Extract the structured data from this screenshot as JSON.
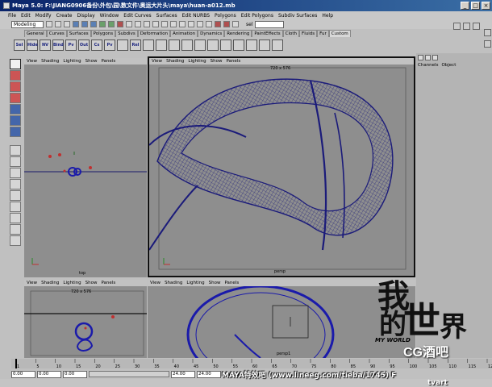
{
  "window": {
    "title": "Maya 5.0: F:\\JIANG0906备份\\外包\\园\\数文件\\奥运大片头\\maya\\huan-a012.mb",
    "minimize": "_",
    "maximize": "□",
    "close": "×"
  },
  "menubar": [
    "File",
    "Edit",
    "Modify",
    "Create",
    "Display",
    "Window",
    "Edit Curves",
    "Surfaces",
    "Edit NURBS",
    "Polygons",
    "Edit Polygons",
    "Subdiv Surfaces",
    "Help"
  ],
  "statusline": {
    "mode": "Modeling",
    "selection_label": "sel"
  },
  "shelf_tabs": [
    "General",
    "Curves",
    "Surfaces",
    "Polygons",
    "Subdivs",
    "Deformation",
    "Animation",
    "Dynamics",
    "Rendering",
    "PaintEffects",
    "Cloth",
    "Fluids",
    "Fur",
    "Custom"
  ],
  "shelf_active_tab": "Custom",
  "shelf_buttons": [
    "Sel",
    "Hide",
    "NV",
    "Bind",
    "Pv",
    "Out",
    "Cs",
    "Pv",
    "",
    "Rel",
    "",
    "",
    "",
    "",
    "",
    "",
    "",
    "",
    "",
    "",
    ""
  ],
  "viewports": {
    "menu": [
      "View",
      "Shading",
      "Lighting",
      "Show",
      "Panels"
    ],
    "top": {
      "camera": "top"
    },
    "persp": {
      "camera": "persp",
      "resolution": "720 x 576"
    },
    "front": {
      "camera": "front",
      "resolution": "720 x 576"
    },
    "persp2": {
      "camera": "persp1"
    }
  },
  "channel_box": {
    "tabs": [
      "Channels",
      "Object"
    ]
  },
  "time": {
    "start": "0.00",
    "range_start": "0.00",
    "current": "0.00",
    "range_end": "24.00",
    "end": "24.00"
  },
  "timeline_ticks": [
    "1",
    "5",
    "10",
    "15",
    "20",
    "25",
    "30",
    "35",
    "40",
    "45",
    "50",
    "55",
    "60",
    "65",
    "70",
    "75",
    "80",
    "85",
    "90",
    "95",
    "100",
    "105",
    "110",
    "115",
    "120"
  ],
  "watermark": {
    "url_text": "MAYA特效吧 (www.lineeg.com/tieba/1745) F",
    "big_text_1": "我",
    "big_text_2": "的",
    "big_text_3": "世",
    "big_text_4": "界",
    "my_world": "MY WORLD",
    "brand": "CG酒吧",
    "brand2": "tvart"
  }
}
